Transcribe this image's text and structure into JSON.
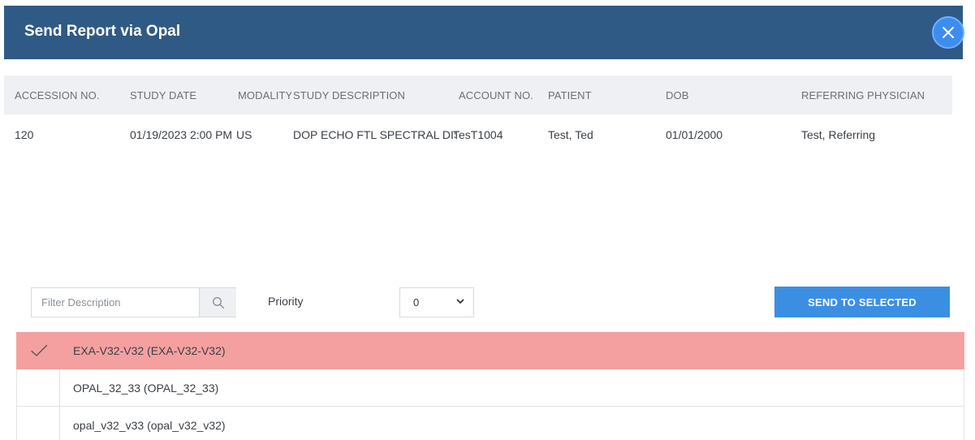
{
  "dialog": {
    "title": "Send Report via Opal"
  },
  "study_table": {
    "columns": [
      {
        "key": "accession",
        "label": "ACCESSION NO."
      },
      {
        "key": "study_date",
        "label": "STUDY DATE"
      },
      {
        "key": "modality",
        "label": "MODALITY"
      },
      {
        "key": "description",
        "label": "STUDY DESCRIPTION"
      },
      {
        "key": "account",
        "label": "ACCOUNT NO."
      },
      {
        "key": "patient",
        "label": "PATIENT"
      },
      {
        "key": "dob",
        "label": "DOB"
      },
      {
        "key": "physician",
        "label": "REFERRING PHYSICIAN"
      }
    ],
    "rows": [
      {
        "accession": "120",
        "study_date": "01/19/2023 2:00 PM",
        "modality": "US",
        "description": "DOP ECHO FTL SPECTRAL DISPLAY",
        "account": "TesT1004",
        "patient": "Test, Ted",
        "dob": "01/01/2000",
        "physician": "Test, Referring"
      }
    ]
  },
  "filter": {
    "placeholder": "Filter Description",
    "value": ""
  },
  "priority": {
    "label": "Priority",
    "selected": "0"
  },
  "send_button": {
    "label": "SEND TO SELECTED"
  },
  "destinations": [
    {
      "label": "EXA-V32-V32 (EXA-V32-V32)",
      "selected": true
    },
    {
      "label": "OPAL_32_33 (OPAL_32_33)",
      "selected": false
    },
    {
      "label": "opal_v32_v33 (opal_v32_v32)",
      "selected": false
    }
  ],
  "colors": {
    "header_bg": "#2f5a85",
    "close_button": "#3d8df0",
    "send_button": "#3b8fe3",
    "selected_row": "#f5a0a0"
  },
  "icons": {
    "close": "close-icon",
    "search": "search-icon",
    "dropdown": "chevron-down-icon",
    "check": "check-icon"
  }
}
